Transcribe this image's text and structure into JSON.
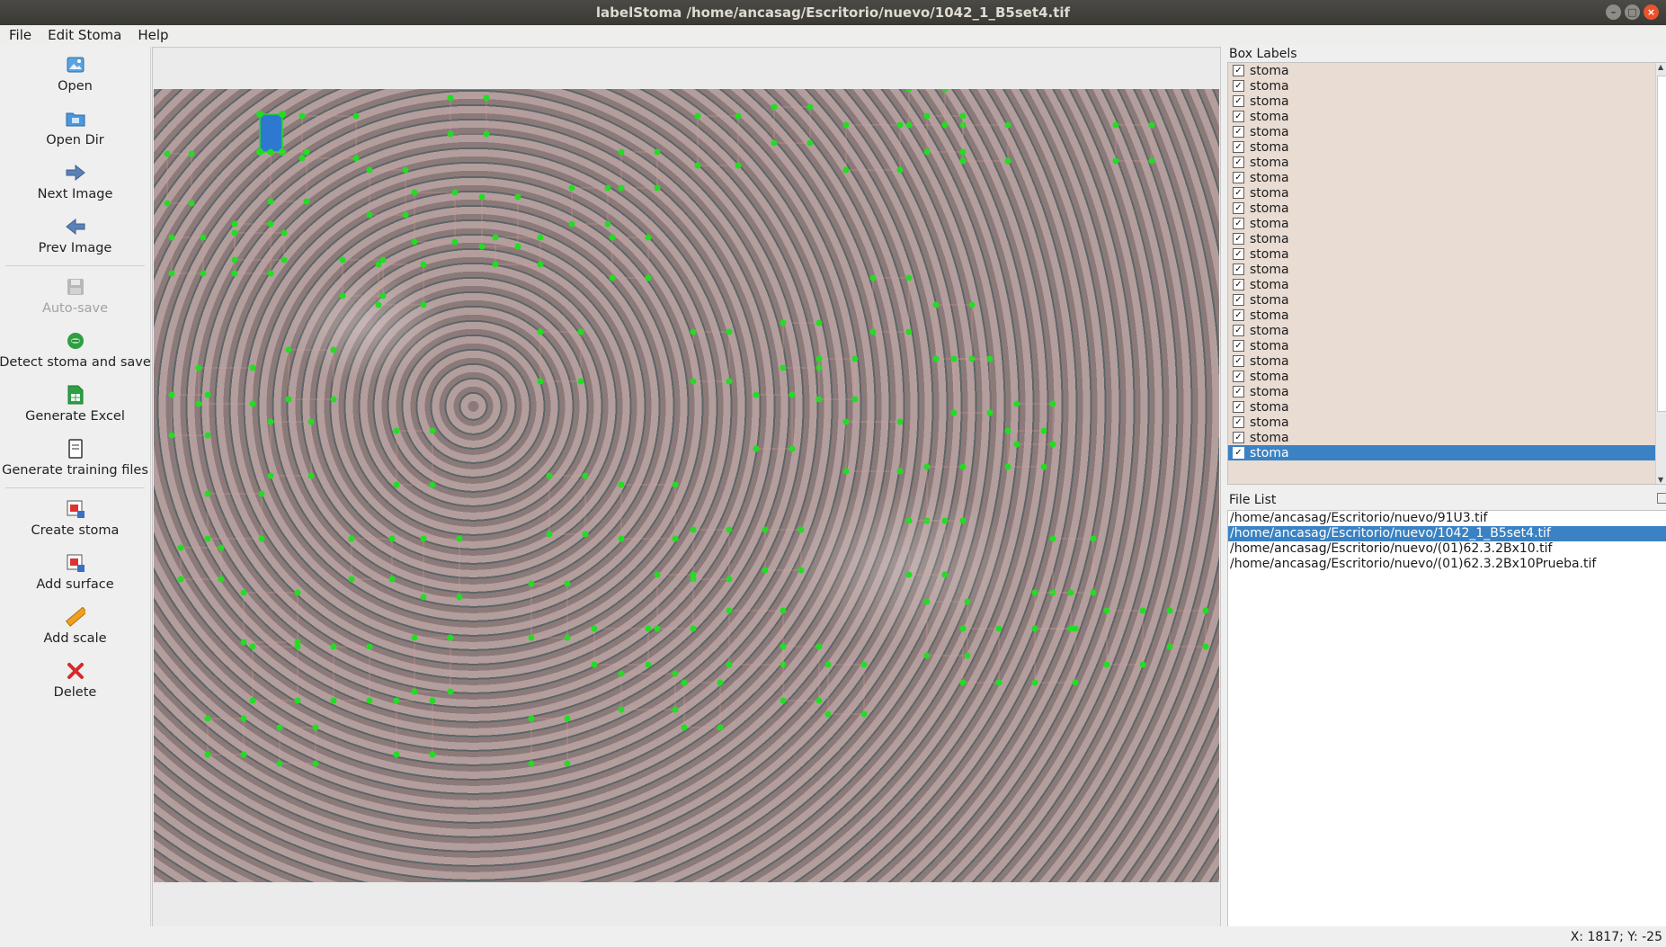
{
  "window": {
    "title": "labelStoma /home/ancasag/Escritorio/nuevo/1042_1_B5set4.tif"
  },
  "menu": [
    {
      "label": "File"
    },
    {
      "label": "Edit Stoma"
    },
    {
      "label": "Help"
    }
  ],
  "toolbar": {
    "open": "Open",
    "open_dir": "Open Dir",
    "next_image": "Next Image",
    "prev_image": "Prev Image",
    "auto_save": "Auto-save",
    "detect": "Detect stoma and save",
    "generate_excel": "Generate Excel",
    "generate_training": "Generate training files",
    "create_stoma": "Create stoma",
    "add_surface": "Add surface",
    "add_scale": "Add scale",
    "delete": "Delete"
  },
  "box_labels": {
    "title": "Box Labels",
    "items": [
      "stoma",
      "stoma",
      "stoma",
      "stoma",
      "stoma",
      "stoma",
      "stoma",
      "stoma",
      "stoma",
      "stoma",
      "stoma",
      "stoma",
      "stoma",
      "stoma",
      "stoma",
      "stoma",
      "stoma",
      "stoma",
      "stoma",
      "stoma",
      "stoma",
      "stoma",
      "stoma",
      "stoma",
      "stoma",
      "stoma"
    ],
    "selected_index": 25
  },
  "file_list": {
    "title": "File List",
    "items": [
      "/home/ancasag/Escritorio/nuevo/91U3.tif",
      "/home/ancasag/Escritorio/nuevo/1042_1_B5set4.tif",
      "/home/ancasag/Escritorio/nuevo/(01)62.3.2Bx10.tif",
      "/home/ancasag/Escritorio/nuevo/(01)62.3.2Bx10Prueba.tif"
    ],
    "selected_index": 1
  },
  "status": {
    "coords": "X: 1817; Y: -25"
  },
  "colors": {
    "selection": "#3a82c4",
    "handle": "#22dd22",
    "box_fill": "#2f78d2"
  }
}
